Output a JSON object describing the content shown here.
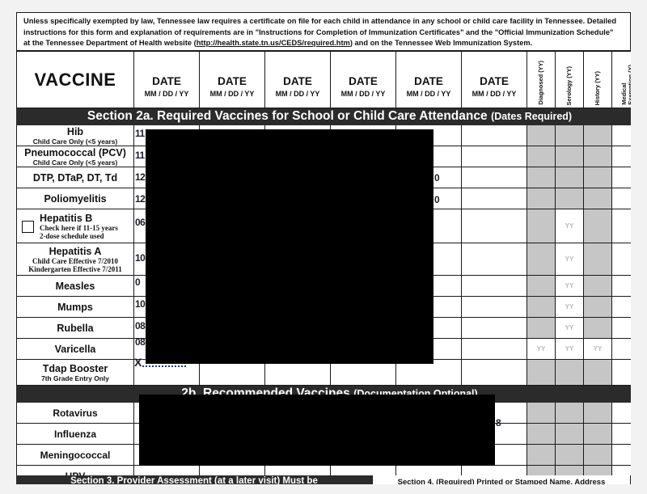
{
  "document": {
    "instructions": {
      "line1": "Unless specifically exempted by law, Tennessee law requires a certificate on file for each child in attendance in any school or child care facility in Tennessee.  Detailed",
      "line2": "instructions for this form and explanation of requirements are in \"Instructions for Completion of Immunization Certificates\" and the \"Official Immunization Schedule\"",
      "line3_pre": "at the Tennessee Department of Health website (",
      "link": "http://health.state.tn.us/CEDS/required.htm",
      "line3_post": ") and on the Tennessee Web Immunization System."
    }
  },
  "table": {
    "header": {
      "vaccine_label": "VACCINE",
      "date_columns": [
        {
          "main": "DATE",
          "sub": "MM / DD / YY"
        },
        {
          "main": "DATE",
          "sub": "MM / DD / YY"
        },
        {
          "main": "DATE",
          "sub": "MM / DD / YY"
        },
        {
          "main": "DATE",
          "sub": "MM / DD / YY"
        },
        {
          "main": "DATE",
          "sub": "MM / DD / YY"
        },
        {
          "main": "DATE",
          "sub": "MM / DD / YY"
        }
      ],
      "rotated_columns": [
        {
          "label": "Diagnosed (YY)"
        },
        {
          "label": "Serology (YY)"
        },
        {
          "label": "History (YY)"
        },
        {
          "label": "Medical\nExemption (X)"
        }
      ]
    },
    "section_2a": {
      "banner_main": "Section 2a. Required Vaccines for School or Child Care Attendance",
      "banner_sub": "(Dates Required)",
      "rows": [
        {
          "name": "Hib",
          "sub1": "Child Care Only (<5 years)",
          "sub2": "",
          "partial_date": "11",
          "diagnosed": "gray",
          "serology": "gray",
          "history": "gray",
          "medical_exemption": ""
        },
        {
          "name": "Pneumococcal (PCV)",
          "sub1": "Child Care Only (<5 years)",
          "sub2": "",
          "partial_date": "11",
          "diagnosed": "gray",
          "serology": "gray",
          "history": "gray",
          "medical_exemption": ""
        },
        {
          "name": "DTP, DTaP, DT, Td",
          "sub1": "",
          "sub2": "",
          "partial_date": "12",
          "partial_date_right": "0",
          "diagnosed": "gray",
          "serology": "gray",
          "history": "gray",
          "medical_exemption": ""
        },
        {
          "name": "Poliomyelitis",
          "sub1": "",
          "sub2": "",
          "partial_date": "12",
          "partial_date_right": "0",
          "diagnosed": "gray",
          "serology": "gray",
          "history": "gray",
          "medical_exemption": ""
        },
        {
          "name": "Hepatitis B",
          "sub1": "Check here if 11-15 years",
          "sub2": "2-dose  schedule used",
          "checkbox": true,
          "partial_date": "06",
          "diagnosed": "gray",
          "serology": "YY",
          "history": "gray",
          "medical_exemption": ""
        },
        {
          "name": "Hepatitis A",
          "sub1": "Child Care Effective 7/2010",
          "sub2": "Kindergarten Effective 7/2011",
          "partial_date": "10",
          "diagnosed": "gray",
          "serology": "YY",
          "history": "gray",
          "medical_exemption": ""
        },
        {
          "name": "Measles",
          "sub1": "",
          "sub2": "",
          "partial_date": "0",
          "diagnosed": "gray",
          "serology": "YY",
          "history": "gray",
          "medical_exemption": ""
        },
        {
          "name": "Mumps",
          "sub1": "",
          "sub2": "",
          "partial_date": "10",
          "diagnosed": "gray",
          "serology": "YY",
          "history": "gray",
          "medical_exemption": ""
        },
        {
          "name": "Rubella",
          "sub1": "",
          "sub2": "",
          "partial_date": "08",
          "diagnosed": "gray",
          "serology": "YY",
          "history": "gray",
          "medical_exemption": ""
        },
        {
          "name": "Varicella",
          "sub1": "",
          "sub2": "",
          "partial_date": "08",
          "diagnosed": "YY",
          "serology": "YY",
          "history": "YY",
          "medical_exemption": ""
        },
        {
          "name": "Tdap Booster",
          "sub1": "7th Grade Entry Only",
          "sub2": "",
          "partial_date": "X",
          "diagnosed": "gray",
          "serology": "gray",
          "history": "gray",
          "medical_exemption": ""
        }
      ]
    },
    "section_2b": {
      "banner_main": "2b. Recommended Vaccines",
      "banner_sub": "(Documentation Optional)",
      "rows": [
        {
          "name": "Rotavirus",
          "diagnosed": "gray",
          "serology": "gray",
          "history": "gray",
          "medical_exemption": ""
        },
        {
          "name": "Influenza",
          "partial_date_right": "8",
          "diagnosed": "gray",
          "serology": "gray",
          "history": "gray",
          "medical_exemption": ""
        },
        {
          "name": "Meningococcal",
          "diagnosed": "gray",
          "serology": "gray",
          "history": "gray",
          "medical_exemption": ""
        },
        {
          "name": "HPV",
          "diagnosed": "gray",
          "serology": "gray",
          "history": "gray",
          "medical_exemption": ""
        }
      ]
    }
  },
  "footer": {
    "section3": "Section 3. Provider Assessment (at a later visit) Must be",
    "section4": "Section 4. (Required) Printed or Stamped Name, Address"
  },
  "colors": {
    "banner_bg": "#2b2b2b",
    "shaded_cell": "#c6c6c6",
    "page_bg": "#f2f2f2",
    "border": "#1a1a1a",
    "redaction": "#000000"
  }
}
